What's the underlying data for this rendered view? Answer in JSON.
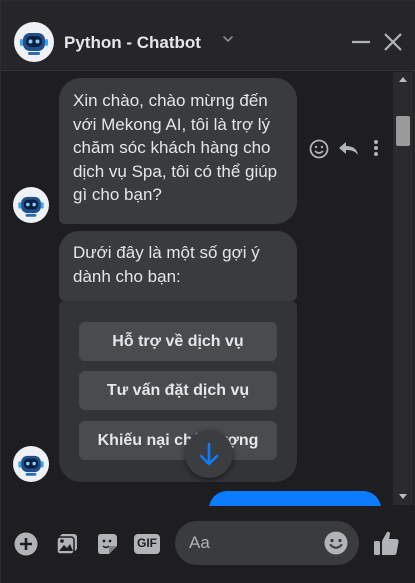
{
  "header": {
    "title": "Python - Chatbot",
    "avatar_icon": "robot-avatar-icon",
    "chevron_icon": "chevron-down-icon",
    "minimize_icon": "minimize-icon",
    "close_icon": "close-icon"
  },
  "messages": {
    "received": [
      {
        "text": "Xin chào, chào mừng đến với Mekong AI, tôi là trợ lý chăm sóc khách hàng cho dịch vụ Spa, tôi có thể giúp gì cho bạn?"
      },
      {
        "text": "Dưới đây là một số gợi ý dành cho bạn:"
      }
    ],
    "quick_replies": [
      {
        "label": "Hỗ trợ về dịch vụ"
      },
      {
        "label": "Tư vấn đặt dịch vụ"
      },
      {
        "label": "Khiếu nại chất lượng"
      }
    ],
    "actions": [
      "emoji-react-icon",
      "reply-icon",
      "more-options-icon"
    ],
    "scroll_down_icon": "arrow-down-icon"
  },
  "footer": {
    "icons": [
      "plus-icon",
      "gallery-icon",
      "sticker-icon",
      "gif-icon"
    ],
    "gif_label": "GIF",
    "input_placeholder": "Aa",
    "emoji_icon": "emoji-icon",
    "like_icon": "thumbs-up-icon"
  },
  "colors": {
    "background": "#1e1e20",
    "bubble": "#3a3b3d",
    "sent_bubble": "#0a7cff",
    "accent": "#0a7cff",
    "text": "#e4e6eb"
  }
}
